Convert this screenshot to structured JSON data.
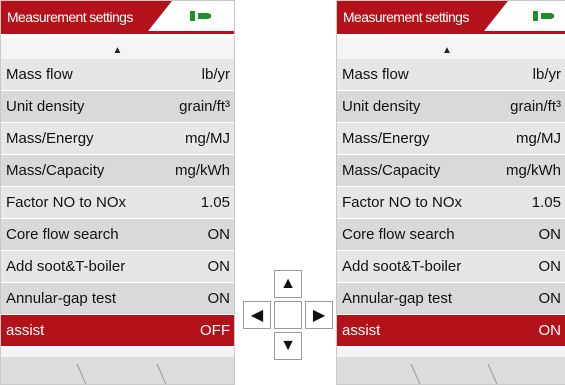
{
  "header": {
    "title": "Measurement settings",
    "battery_icon": "battery-icon"
  },
  "left_screen": {
    "rows": [
      {
        "label": "Mass flow",
        "value": "lb/yr"
      },
      {
        "label": "Unit density",
        "value": "grain/ft³"
      },
      {
        "label": "Mass/Energy",
        "value": "mg/MJ"
      },
      {
        "label": "Mass/Capacity",
        "value": "mg/kWh"
      },
      {
        "label": "Factor NO to NOx",
        "value": "1.05"
      },
      {
        "label": "Core flow search",
        "value": "ON"
      },
      {
        "label": "Add soot&T-boiler",
        "value": "ON"
      },
      {
        "label": "Annular-gap test",
        "value": "ON"
      },
      {
        "label": "assist",
        "value": "OFF"
      }
    ]
  },
  "right_screen": {
    "rows": [
      {
        "label": "Mass flow",
        "value": "lb/yr"
      },
      {
        "label": "Unit density",
        "value": "grain/ft³"
      },
      {
        "label": "Mass/Energy",
        "value": "mg/MJ"
      },
      {
        "label": "Mass/Capacity",
        "value": "mg/kWh"
      },
      {
        "label": "Factor NO to NOx",
        "value": "1.05"
      },
      {
        "label": "Core flow search",
        "value": "ON"
      },
      {
        "label": "Add soot&T-boiler",
        "value": "ON"
      },
      {
        "label": "Annular-gap test",
        "value": "ON"
      },
      {
        "label": "assist",
        "value": "ON"
      }
    ]
  },
  "dpad": {
    "up": "▲",
    "down": "▼",
    "left": "◀",
    "right": "▶"
  },
  "colors": {
    "accent": "#b3121a",
    "battery": "#1e8f2a"
  }
}
